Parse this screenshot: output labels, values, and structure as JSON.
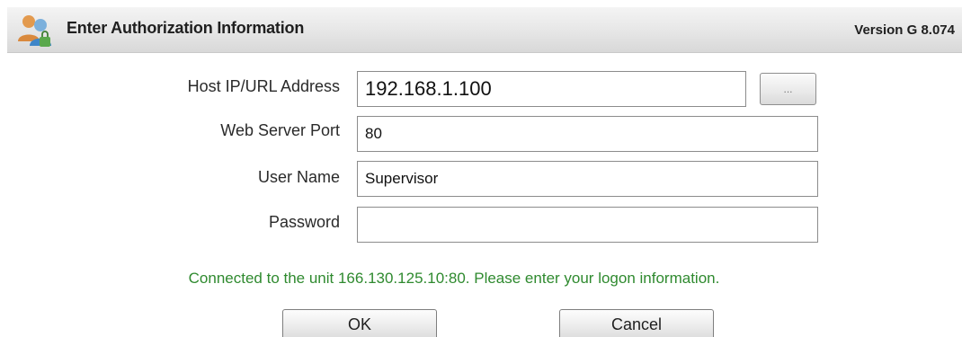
{
  "header": {
    "title": "Enter Authorization Information",
    "version": "Version G 8.074",
    "icon": "users-icon"
  },
  "fields": {
    "host": {
      "label": "Host IP/URL Address",
      "value": "192.168.1.100"
    },
    "port": {
      "label": "Web Server Port",
      "value": "80"
    },
    "username": {
      "label": "User Name",
      "value": "Supervisor"
    },
    "password": {
      "label": "Password",
      "value": ""
    }
  },
  "browse_button": {
    "label": "..."
  },
  "status_message": "Connected to the unit 166.130.125.10:80. Please enter your logon information.",
  "buttons": {
    "ok": "OK",
    "cancel": "Cancel"
  },
  "colors": {
    "status": "#2f8a2f",
    "header_bg": "#e6e6e6"
  }
}
